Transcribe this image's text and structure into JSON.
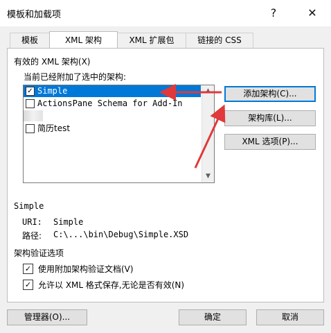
{
  "window": {
    "title": "模板和加载项",
    "help": "?",
    "close": "✕"
  },
  "tabs": [
    "模板",
    "XML 架构",
    "XML 扩展包",
    "链接的 CSS"
  ],
  "section": {
    "available_label": "有效的 XML 架构(X)",
    "attached_label": "当前已经附加了选中的架构:"
  },
  "schemas": [
    {
      "label": "Simple",
      "checked": true,
      "selected": true
    },
    {
      "label": "ActionsPane Schema for Add-In",
      "checked": false
    },
    {
      "label": "",
      "checked": false
    },
    {
      "label": "简历test",
      "checked": false
    }
  ],
  "buttons": {
    "add_schema": "添加架构(C)...",
    "schema_library": "架构库(L)...",
    "xml_options": "XML 选项(P)...",
    "organizer": "管理器(O)...",
    "ok": "确定",
    "cancel": "取消"
  },
  "details": {
    "name": "Simple",
    "uri_label": "URI:",
    "uri_value": "Simple",
    "path_label": "路径:",
    "path_value": "C:\\...\\bin\\Debug\\Simple.XSD"
  },
  "validation": {
    "title": "架构验证选项",
    "options": [
      {
        "label": "使用附加架构验证文档(V)",
        "checked": true
      },
      {
        "label": "允许以 XML 格式保存,无论是否有效(N)",
        "checked": true
      }
    ]
  },
  "annotation_color": "#e0393b"
}
